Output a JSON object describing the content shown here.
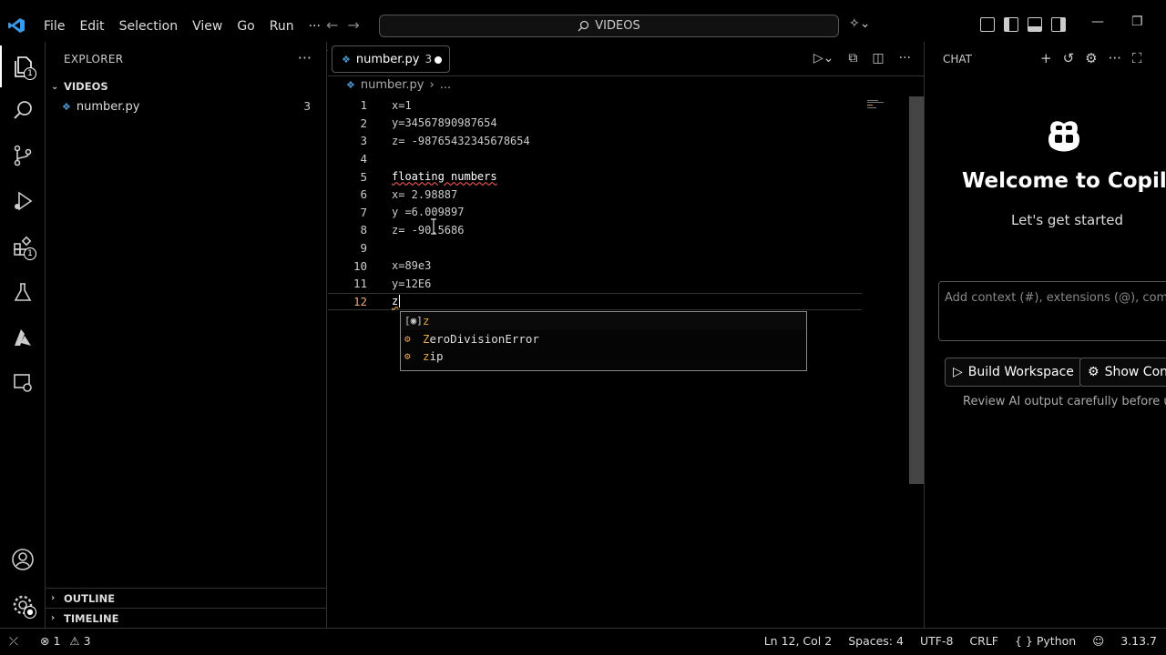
{
  "menu": [
    "File",
    "Edit",
    "Selection",
    "View",
    "Go",
    "Run"
  ],
  "menu_more": "···",
  "command_center": {
    "label": "VIDEOS"
  },
  "explorer": {
    "title": "EXPLORER",
    "more": "···",
    "folder": "VIDEOS",
    "file": {
      "name": "number.py",
      "problems": "3"
    },
    "outline": "OUTLINE",
    "timeline": "TIMELINE"
  },
  "activity_badges": {
    "explorer": "1",
    "extensions": "1"
  },
  "tab": {
    "name": "number.py",
    "problems": "3"
  },
  "breadcrumb": {
    "file": "number.py",
    "rest": "..."
  },
  "code_lines": [
    {
      "n": "1",
      "text": "x=1"
    },
    {
      "n": "2",
      "text": "y=34567890987654"
    },
    {
      "n": "3",
      "text": "z= -98765432345678654"
    },
    {
      "n": "4",
      "text": ""
    },
    {
      "n": "5",
      "text": "floating numbers"
    },
    {
      "n": "6",
      "text": "x= 2.98887"
    },
    {
      "n": "7",
      "text": "y =6.009897"
    },
    {
      "n": "8",
      "text": "z= -90.5686"
    },
    {
      "n": "9",
      "text": ""
    },
    {
      "n": "10",
      "text": "x=89e3"
    },
    {
      "n": "11",
      "text": "y=12E6"
    },
    {
      "n": "12",
      "text": "z"
    }
  ],
  "suggestions": [
    {
      "highlight": "z",
      "rest": "",
      "icon": "variable-icon"
    },
    {
      "highlight": "Z",
      "rest": "eroDivisionError",
      "icon": "class-icon"
    },
    {
      "highlight": "z",
      "rest": "ip",
      "icon": "class-icon"
    }
  ],
  "chat": {
    "title": "CHAT",
    "welcome": "Welcome to Copilot",
    "subtitle": "Let's get started",
    "input_placeholder": "Add context (#), extensions (@), commands",
    "build_button": "Build Workspace",
    "config_button": "Show Config",
    "review": "Review AI output carefully before use."
  },
  "status": {
    "errors": "1",
    "warnings": "3",
    "position": "Ln 12, Col 2",
    "spaces": "Spaces: 4",
    "encoding": "UTF-8",
    "eol": "CRLF",
    "language": "Python",
    "version": "3.13.7"
  }
}
